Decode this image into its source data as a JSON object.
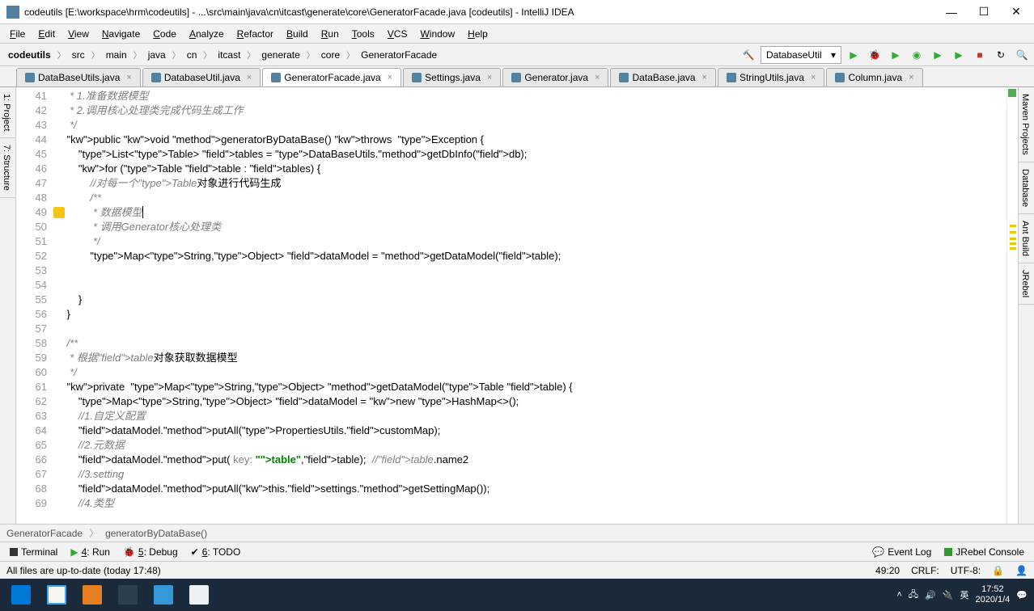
{
  "window": {
    "title": "codeutils [E:\\workspace\\hrm\\codeutils] - ...\\src\\main\\java\\cn\\itcast\\generate\\core\\GeneratorFacade.java [codeutils] - IntelliJ IDEA"
  },
  "menu": [
    "File",
    "Edit",
    "View",
    "Navigate",
    "Code",
    "Analyze",
    "Refactor",
    "Build",
    "Run",
    "Tools",
    "VCS",
    "Window",
    "Help"
  ],
  "breadcrumb": [
    "codeutils",
    "src",
    "main",
    "java",
    "cn",
    "itcast",
    "generate",
    "core",
    "GeneratorFacade"
  ],
  "run_config": "DatabaseUtil",
  "tabs": [
    {
      "label": "DataBaseUtils.java",
      "active": false
    },
    {
      "label": "DatabaseUtil.java",
      "active": false
    },
    {
      "label": "GeneratorFacade.java",
      "active": true
    },
    {
      "label": "Settings.java",
      "active": false
    },
    {
      "label": "Generator.java",
      "active": false
    },
    {
      "label": "DataBase.java",
      "active": false
    },
    {
      "label": "StringUtils.java",
      "active": false
    },
    {
      "label": "Column.java",
      "active": false
    }
  ],
  "lines": {
    "start": 41,
    "end": 69
  },
  "code": [
    "     * 1.准备数据模型",
    "     * 2.调用核心处理类完成代码生成工作",
    "     */",
    "    public void generatorByDataBase() throws  Exception {",
    "        List<Table> tables = DataBaseUtils.getDbInfo(db);",
    "        for (Table table : tables) {",
    "            //对每一个Table对象进行代码生成",
    "            /**",
    "             * 数据模型",
    "             * 调用Generator核心处理类",
    "             */",
    "            Map<String,Object> dataModel = getDataModel(table);",
    "",
    "",
    "        }",
    "    }",
    "",
    "    /**",
    "     * 根据table对象获取数据模型",
    "     */",
    "    private  Map<String,Object> getDataModel(Table table) {",
    "        Map<String,Object> dataModel = new HashMap<>();",
    "        //1.自定义配置",
    "        dataModel.putAll(PropertiesUtils.customMap);",
    "        //2.元数据",
    "        dataModel.put( key: \"table\",table);  //table.name2",
    "        //3.setting",
    "        dataModel.putAll(this.settings.getSettingMap());",
    "        //4.类型"
  ],
  "crumbs": [
    "GeneratorFacade",
    "generatorByDataBase()"
  ],
  "bottom_tools": {
    "terminal": "Terminal",
    "run": "4: Run",
    "debug": "5: Debug",
    "todo": "6: TODO",
    "event_log": "Event Log",
    "jrebel": "JRebel Console"
  },
  "status": {
    "msg": "All files are up-to-date (today 17:48)",
    "pos": "49:20",
    "eol": "CRLF:",
    "enc": "UTF-8:",
    "lock": "🔓"
  },
  "left_tools": [
    "1: Project",
    "7: Structure"
  ],
  "right_tools": [
    "Maven Projects",
    "Database",
    "Ant Build",
    "JRebel"
  ],
  "tray": {
    "time": "17:52",
    "date": "2020/1/4",
    "lang": "英"
  }
}
